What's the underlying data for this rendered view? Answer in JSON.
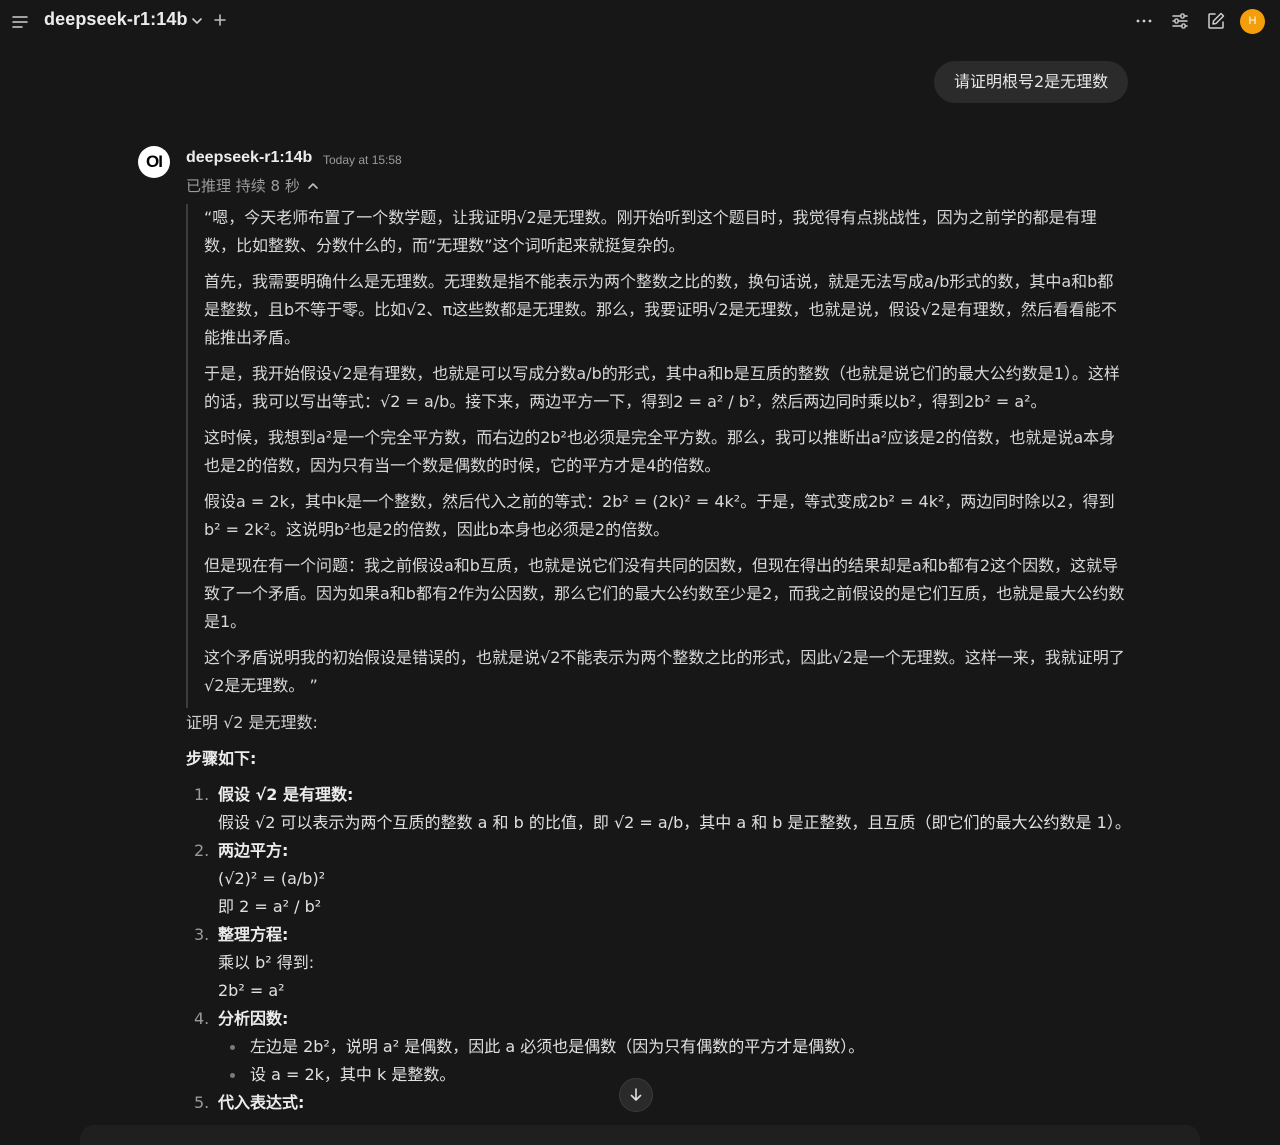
{
  "header": {
    "model_name": "deepseek-r1:14b",
    "avatar_initial": "H"
  },
  "user_message": "请证明根号2是无理数",
  "assistant": {
    "logo_text": "OI",
    "name": "deepseek-r1:14b",
    "timestamp": "Today at 15:58",
    "thinking_label": "已推理 持续 8 秒",
    "thinking_paragraphs": [
      "“嗯，今天老师布置了一个数学题，让我证明√2是无理数。刚开始听到这个题目时，我觉得有点挑战性，因为之前学的都是有理数，比如整数、分数什么的，而“无理数”这个词听起来就挺复杂的。",
      "首先，我需要明确什么是无理数。无理数是指不能表示为两个整数之比的数，换句话说，就是无法写成a/b形式的数，其中a和b都是整数，且b不等于零。比如√2、π这些数都是无理数。那么，我要证明√2是无理数，也就是说，假设√2是有理数，然后看看能不能推出矛盾。",
      "于是，我开始假设√2是有理数，也就是可以写成分数a/b的形式，其中a和b是互质的整数（也就是说它们的最大公约数是1）。这样的话，我可以写出等式：√2 = a/b。接下来，两边平方一下，得到2 = a² / b²，然后两边同时乘以b²，得到2b² = a²。",
      "这时候，我想到a²是一个完全平方数，而右边的2b²也必须是完全平方数。那么，我可以推断出a²应该是2的倍数，也就是说a本身也是2的倍数，因为只有当一个数是偶数的时候，它的平方才是4的倍数。",
      "假设a = 2k，其中k是一个整数，然后代入之前的等式：2b² = (2k)² = 4k²。于是，等式变成2b² = 4k²，两边同时除以2，得到b² = 2k²。这说明b²也是2的倍数，因此b本身也必须是2的倍数。",
      "但是现在有一个问题：我之前假设a和b互质，也就是说它们没有共同的因数，但现在得出的结果却是a和b都有2这个因数，这就导致了一个矛盾。因为如果a和b都有2作为公因数，那么它们的最大公约数至少是2，而我之前假设的是它们互质，也就是最大公约数是1。",
      "这个矛盾说明我的初始假设是错误的，也就是说√2不能表示为两个整数之比的形式，因此√2是一个无理数。这样一来，我就证明了√2是无理数。 ”"
    ],
    "answer_intro": "证明 √2 是无理数:",
    "steps_heading": "步骤如下:",
    "steps": [
      {
        "num": "1.",
        "title": "假设 √2 是有理数:",
        "lines": [
          "假设 √2 可以表示为两个互质的整数 a 和 b 的比值，即 √2 = a/b，其中 a 和 b 是正整数，且互质（即它们的最大公约数是 1）。"
        ]
      },
      {
        "num": "2.",
        "title": "两边平方:",
        "lines": [
          "(√2)² = (a/b)²",
          "即 2 = a² / b²"
        ]
      },
      {
        "num": "3.",
        "title": "整理方程:",
        "lines": [
          "乘以 b² 得到:",
          "2b² = a²"
        ]
      },
      {
        "num": "4.",
        "title": "分析因数:",
        "bullets": [
          "左边是 2b²，说明 a² 是偶数，因此 a 必须也是偶数（因为只有偶数的平方才是偶数）。",
          "设 a = 2k，其中 k 是整数。"
        ]
      },
      {
        "num": "5.",
        "title": "代入表达式:"
      }
    ]
  }
}
